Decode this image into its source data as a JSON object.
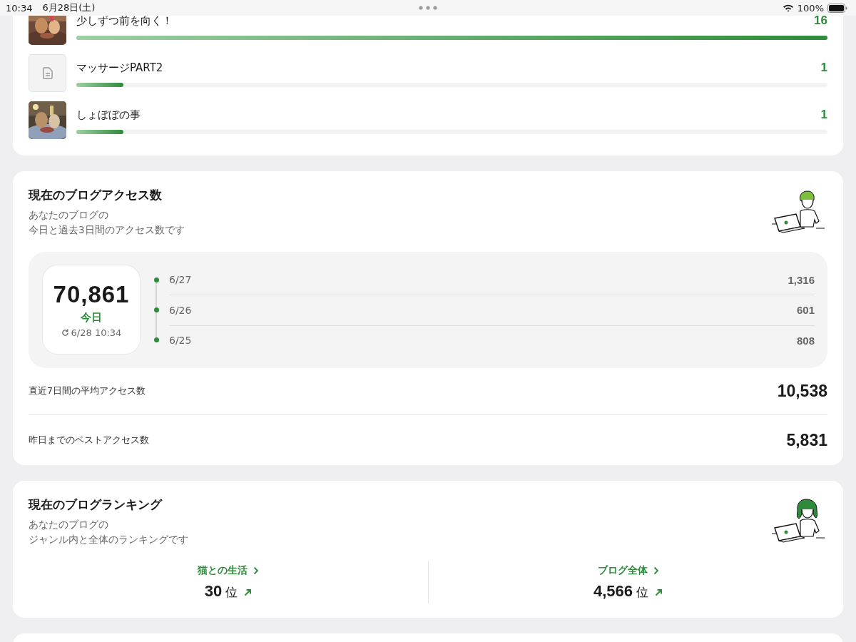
{
  "status_bar": {
    "time": "10:34",
    "date": "6月28日(土)",
    "battery": "100%"
  },
  "popular_posts": [
    {
      "title": "少しずつ前を向く！",
      "count": "16",
      "level": 1.0
    },
    {
      "title": "マッサージPART2",
      "count": "1",
      "level": 0.063,
      "thumbnail": {
        "kind": "placeholder"
      }
    },
    {
      "title": "しょぼぼの事",
      "count": "1",
      "level": 0.063
    }
  ],
  "access": {
    "title": "現在のブログアクセス数",
    "subtitle": [
      "あなたのブログの",
      "今日と過去3日間のアクセス数です"
    ],
    "today": {
      "value": "70,861",
      "label": "今日",
      "updated": "6/28 10:34"
    },
    "history": [
      {
        "date": "6/27",
        "value": "1,316"
      },
      {
        "date": "6/26",
        "value": "601"
      },
      {
        "date": "6/25",
        "value": "808"
      }
    ],
    "stats": [
      {
        "label": "直近7日間の平均アクセス数",
        "value": "10,538"
      },
      {
        "label": "昨日までのベストアクセス数",
        "value": "5,831"
      }
    ]
  },
  "ranking": {
    "title": "現在のブログランキング",
    "subtitle": [
      "あなたのブログの",
      "ジャンル内と全体のランキングです"
    ],
    "items": [
      {
        "label": "猫との生活",
        "value": "30",
        "unit": "位",
        "rising": true
      },
      {
        "label": "ブログ全体",
        "value": "4,566",
        "unit": "位",
        "rising": true
      }
    ]
  }
}
